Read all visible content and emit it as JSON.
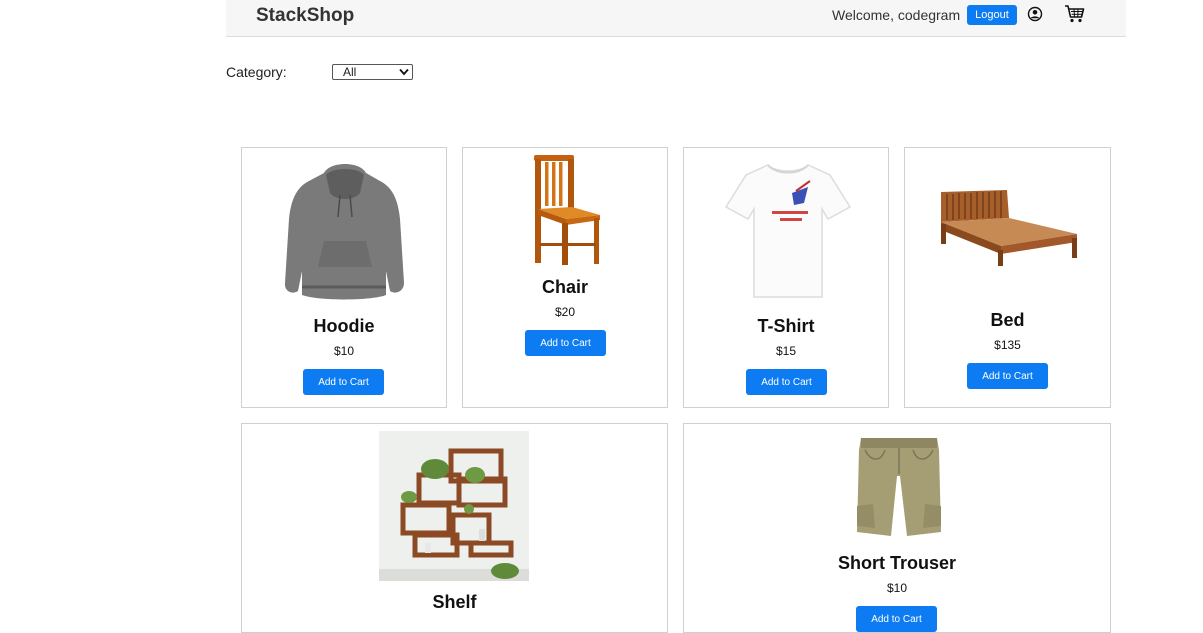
{
  "header": {
    "brand": "StackShop",
    "welcome": "Welcome, codegram",
    "logout_label": "Logout",
    "user_icon": "user-circle-icon",
    "cart_icon": "shopping-cart-icon"
  },
  "filter": {
    "label": "Category:",
    "selected": "All"
  },
  "products": [
    {
      "name": "Hoodie",
      "price": "$10",
      "button": "Add to Cart",
      "image": "hoodie-image"
    },
    {
      "name": "Chair",
      "price": "$20",
      "button": "Add to Cart",
      "image": "chair-image"
    },
    {
      "name": "T-Shirt",
      "price": "$15",
      "button": "Add to Cart",
      "image": "tshirt-image"
    },
    {
      "name": "Bed",
      "price": "$135",
      "button": "Add to Cart",
      "image": "bed-image"
    },
    {
      "name": "Shelf",
      "price": "",
      "button": "",
      "image": "shelf-image"
    },
    {
      "name": "Short Trouser",
      "price": "$10",
      "button": "Add to Cart",
      "image": "shorts-image"
    }
  ],
  "colors": {
    "accent": "#0d7cf2",
    "navbar_bg": "#f6f6f6"
  }
}
